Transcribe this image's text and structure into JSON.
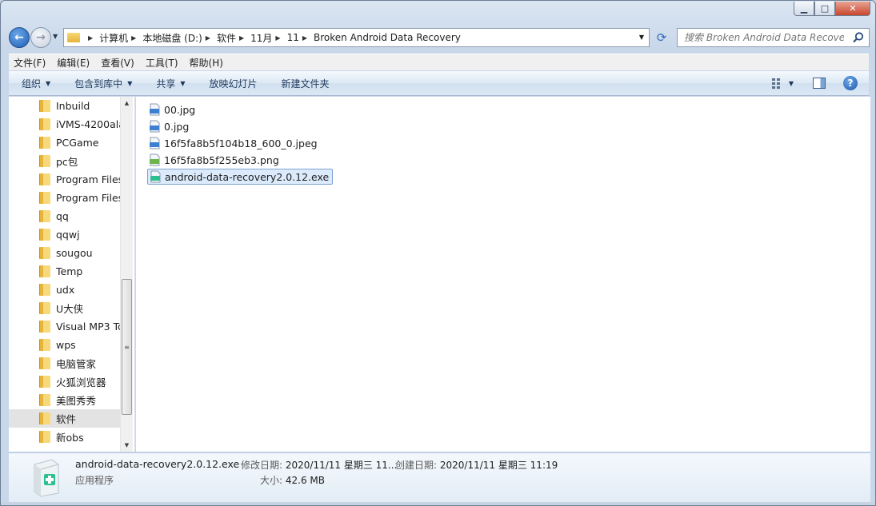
{
  "window": {
    "caption": {
      "minimize": "▁",
      "maximize": "□",
      "close": "✕"
    }
  },
  "address": {
    "crumbs": [
      "计算机",
      "本地磁盘 (D:)",
      "软件",
      "11月",
      "11",
      "Broken Android Data Recovery"
    ]
  },
  "search": {
    "placeholder": "搜索 Broken Android Data Recove..."
  },
  "menu": [
    "文件(F)",
    "编辑(E)",
    "查看(V)",
    "工具(T)",
    "帮助(H)"
  ],
  "commands": [
    {
      "label": "组织",
      "has_caret": true
    },
    {
      "label": "包含到库中",
      "has_caret": true
    },
    {
      "label": "共享",
      "has_caret": true
    },
    {
      "label": "放映幻灯片",
      "has_caret": false
    },
    {
      "label": "新建文件夹",
      "has_caret": false
    }
  ],
  "tree": [
    {
      "label": "Inbuild"
    },
    {
      "label": "iVMS-4200ala"
    },
    {
      "label": "PCGame"
    },
    {
      "label": "pc包"
    },
    {
      "label": "Program Files"
    },
    {
      "label": "Program Files"
    },
    {
      "label": "qq"
    },
    {
      "label": "qqwj"
    },
    {
      "label": "sougou"
    },
    {
      "label": "Temp"
    },
    {
      "label": "udx"
    },
    {
      "label": "U大侠"
    },
    {
      "label": "Visual MP3 Tc"
    },
    {
      "label": "wps"
    },
    {
      "label": "电脑管家"
    },
    {
      "label": "火狐浏览器"
    },
    {
      "label": "美图秀秀"
    },
    {
      "label": "软件",
      "selected": true
    },
    {
      "label": "新obs"
    }
  ],
  "files": [
    {
      "name": "00.jpg",
      "icon": "jpg-file-icon"
    },
    {
      "name": "0.jpg",
      "icon": "jpg-file-icon"
    },
    {
      "name": "16f5fa8b5f104b18_600_0.jpeg",
      "icon": "jpg-file-icon"
    },
    {
      "name": "16f5fa8b5f255eb3.png",
      "icon": "png-file-icon"
    },
    {
      "name": "android-data-recovery2.0.12.exe",
      "icon": "exe-file-icon",
      "selected": true
    }
  ],
  "details": {
    "name": "android-data-recovery2.0.12.exe",
    "type": "应用程序",
    "modified_label": "修改日期:",
    "modified_value": "2020/11/11 星期三 11...",
    "created_label": "创建日期:",
    "created_value": "2020/11/11 星期三 11:19",
    "size_label": "大小:",
    "size_value": "42.6 MB"
  },
  "colors": {
    "selection_bg": "#dcebfc",
    "selection_border": "#7da2ce",
    "command_text": "#1e395b"
  }
}
